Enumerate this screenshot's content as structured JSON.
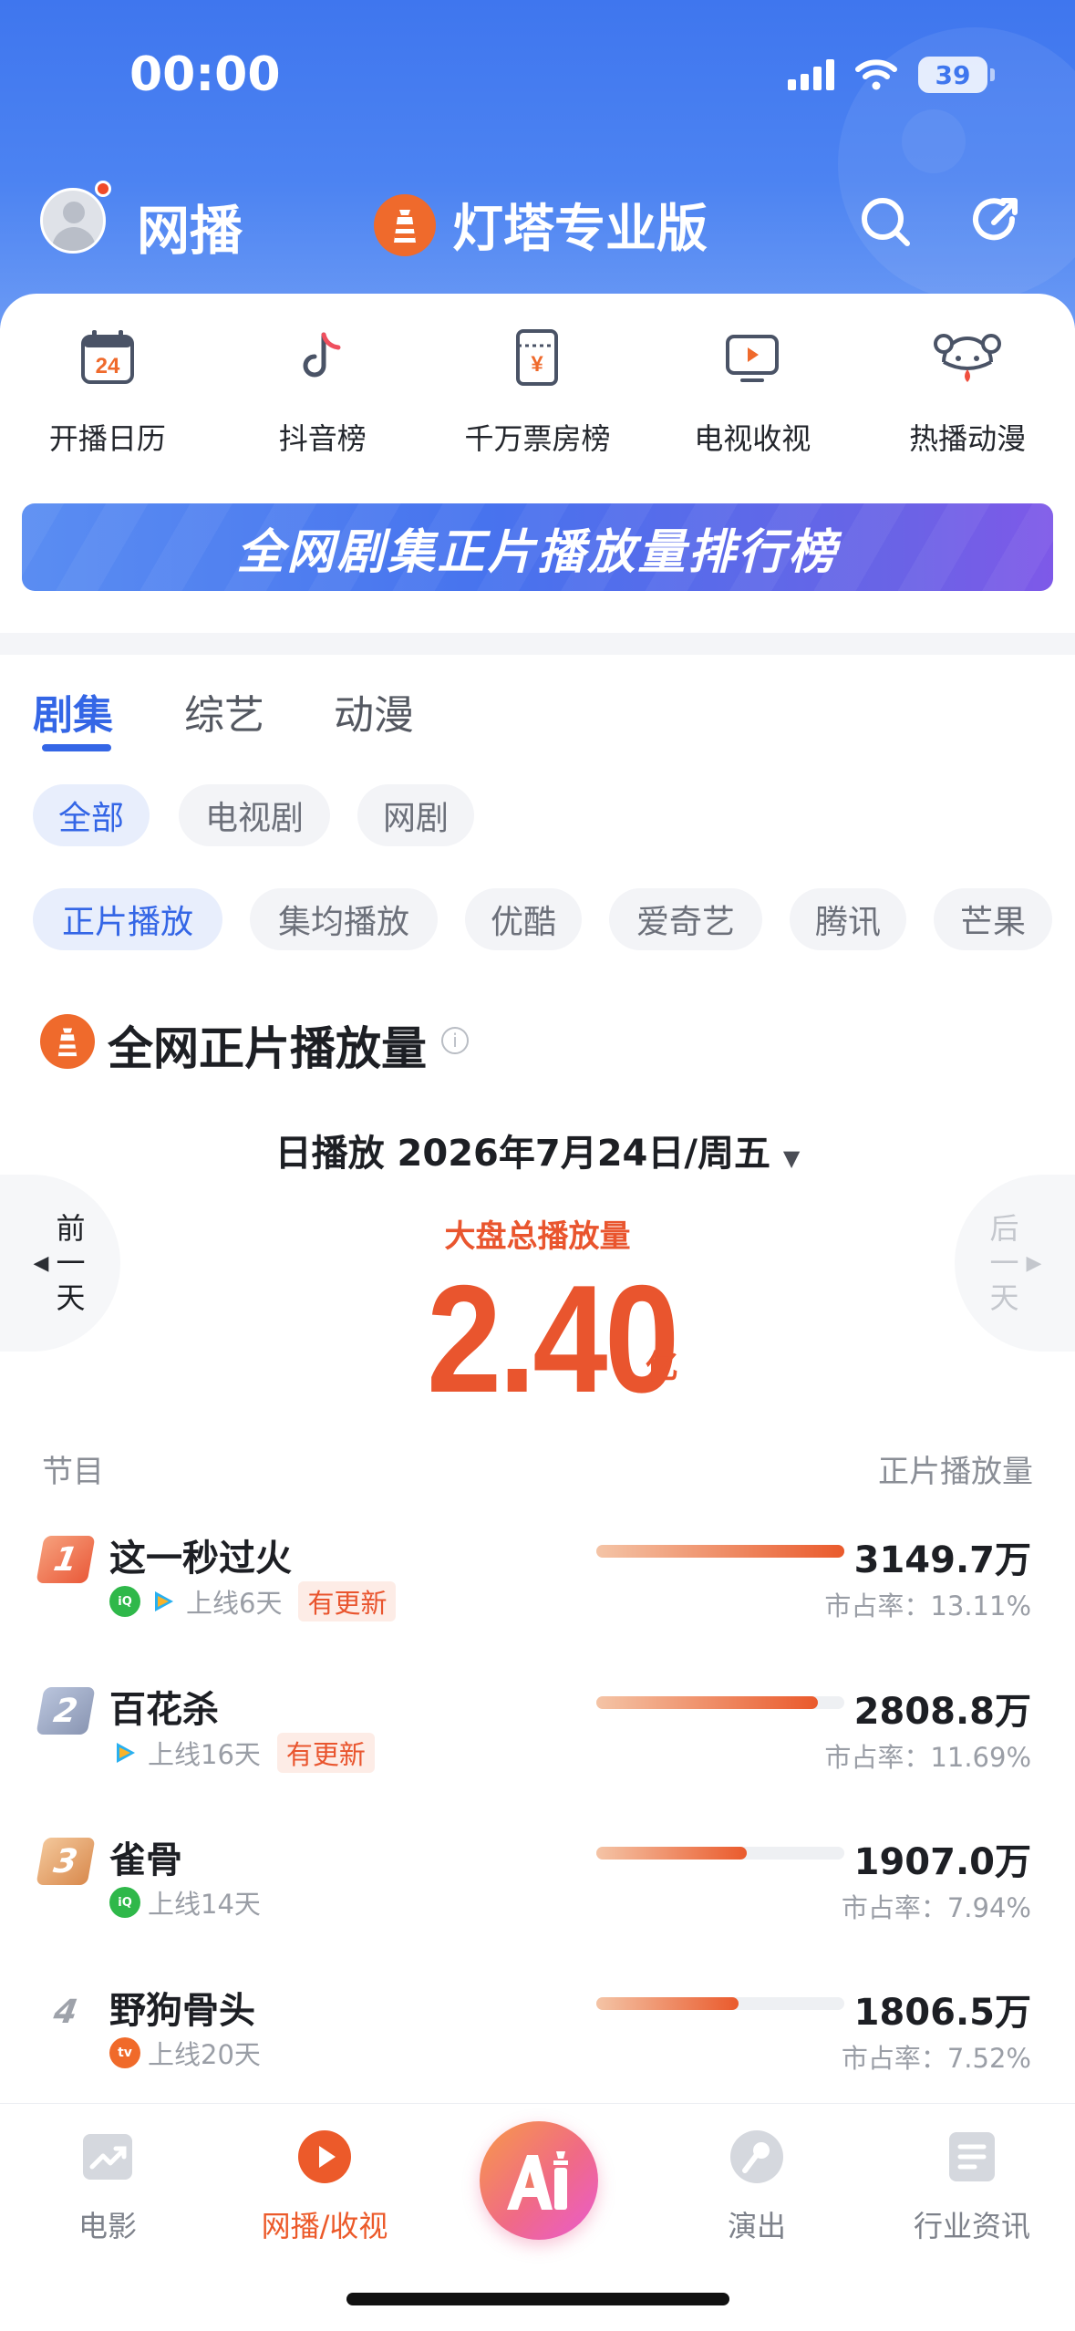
{
  "status_bar": {
    "time": "00:00",
    "battery": "39"
  },
  "header": {
    "title": "网播",
    "brand": "灯塔专业版"
  },
  "quick_nav": [
    {
      "label": "开播日历",
      "icon": "calendar-icon",
      "badge": "24"
    },
    {
      "label": "抖音榜",
      "icon": "douyin-icon"
    },
    {
      "label": "千万票房榜",
      "icon": "ticket-icon",
      "badge": "¥"
    },
    {
      "label": "电视收视",
      "icon": "tv-icon"
    },
    {
      "label": "热播动漫",
      "icon": "anime-icon"
    }
  ],
  "banner": {
    "text": "全网剧集正片播放量排行榜"
  },
  "tabs": [
    "剧集",
    "综艺",
    "动漫"
  ],
  "filter1": [
    "全部",
    "电视剧",
    "网剧"
  ],
  "filter2": [
    "正片播放",
    "集均播放",
    "优酷",
    "爱奇艺",
    "腾讯",
    "芒果"
  ],
  "section": {
    "title": "全网正片播放量",
    "info": "i"
  },
  "date_line": "日播放 2026年7月24日/周五",
  "prev_label": [
    "前",
    "一",
    "天"
  ],
  "next_label": [
    "后",
    "一",
    "天"
  ],
  "total": {
    "label": "大盘总播放量",
    "value": "2.40",
    "unit": "亿"
  },
  "columns": {
    "left": "节目",
    "right": "正片播放量"
  },
  "rows": [
    {
      "rank": "1",
      "name": "这一秒过火",
      "platforms": [
        "iqiyi",
        "tencent"
      ],
      "days": "上线6天",
      "tag": "有更新",
      "value": "3149.7万",
      "share": "市占率：13.11%",
      "share_pct": 13.11
    },
    {
      "rank": "2",
      "name": "百花杀",
      "platforms": [
        "tencent"
      ],
      "days": "上线16天",
      "tag": "有更新",
      "value": "2808.8万",
      "share": "市占率：11.69%",
      "share_pct": 11.69
    },
    {
      "rank": "3",
      "name": "雀骨",
      "platforms": [
        "iqiyi"
      ],
      "days": "上线14天",
      "tag": "",
      "value": "1907.0万",
      "share": "市占率：7.94%",
      "share_pct": 7.94
    },
    {
      "rank": "4",
      "name": "野狗骨头",
      "platforms": [
        "mango"
      ],
      "days": "上线20天",
      "tag": "",
      "value": "1806.5万",
      "share": "市占率：7.52%",
      "share_pct": 7.52
    }
  ],
  "bottom_nav": [
    {
      "label": "电影",
      "icon": "movie-trend-icon",
      "active": false
    },
    {
      "label": "网播/收视",
      "icon": "play-icon",
      "active": true
    },
    {
      "label": "演出",
      "icon": "microphone-icon",
      "active": false
    },
    {
      "label": "行业资讯",
      "icon": "news-icon",
      "active": false
    }
  ],
  "colors": {
    "brand_blue": "#3f76ee",
    "accent_orange": "#e9552e",
    "active_tab": "#3466e6"
  }
}
